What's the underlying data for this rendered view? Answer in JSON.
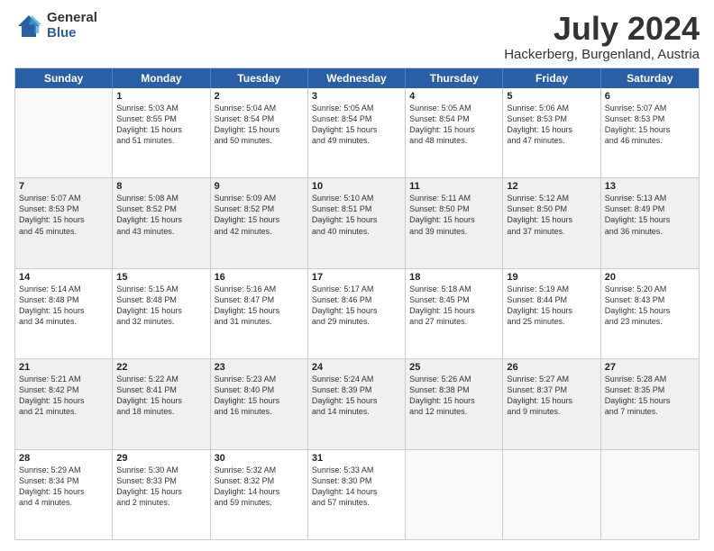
{
  "logo": {
    "general": "General",
    "blue": "Blue"
  },
  "title": "July 2024",
  "subtitle": "Hackerberg, Burgenland, Austria",
  "weekdays": [
    "Sunday",
    "Monday",
    "Tuesday",
    "Wednesday",
    "Thursday",
    "Friday",
    "Saturday"
  ],
  "rows": [
    [
      {
        "day": "",
        "text": ""
      },
      {
        "day": "1",
        "text": "Sunrise: 5:03 AM\nSunset: 8:55 PM\nDaylight: 15 hours\nand 51 minutes."
      },
      {
        "day": "2",
        "text": "Sunrise: 5:04 AM\nSunset: 8:54 PM\nDaylight: 15 hours\nand 50 minutes."
      },
      {
        "day": "3",
        "text": "Sunrise: 5:05 AM\nSunset: 8:54 PM\nDaylight: 15 hours\nand 49 minutes."
      },
      {
        "day": "4",
        "text": "Sunrise: 5:05 AM\nSunset: 8:54 PM\nDaylight: 15 hours\nand 48 minutes."
      },
      {
        "day": "5",
        "text": "Sunrise: 5:06 AM\nSunset: 8:53 PM\nDaylight: 15 hours\nand 47 minutes."
      },
      {
        "day": "6",
        "text": "Sunrise: 5:07 AM\nSunset: 8:53 PM\nDaylight: 15 hours\nand 46 minutes."
      }
    ],
    [
      {
        "day": "7",
        "text": "Sunrise: 5:07 AM\nSunset: 8:53 PM\nDaylight: 15 hours\nand 45 minutes."
      },
      {
        "day": "8",
        "text": "Sunrise: 5:08 AM\nSunset: 8:52 PM\nDaylight: 15 hours\nand 43 minutes."
      },
      {
        "day": "9",
        "text": "Sunrise: 5:09 AM\nSunset: 8:52 PM\nDaylight: 15 hours\nand 42 minutes."
      },
      {
        "day": "10",
        "text": "Sunrise: 5:10 AM\nSunset: 8:51 PM\nDaylight: 15 hours\nand 40 minutes."
      },
      {
        "day": "11",
        "text": "Sunrise: 5:11 AM\nSunset: 8:50 PM\nDaylight: 15 hours\nand 39 minutes."
      },
      {
        "day": "12",
        "text": "Sunrise: 5:12 AM\nSunset: 8:50 PM\nDaylight: 15 hours\nand 37 minutes."
      },
      {
        "day": "13",
        "text": "Sunrise: 5:13 AM\nSunset: 8:49 PM\nDaylight: 15 hours\nand 36 minutes."
      }
    ],
    [
      {
        "day": "14",
        "text": "Sunrise: 5:14 AM\nSunset: 8:48 PM\nDaylight: 15 hours\nand 34 minutes."
      },
      {
        "day": "15",
        "text": "Sunrise: 5:15 AM\nSunset: 8:48 PM\nDaylight: 15 hours\nand 32 minutes."
      },
      {
        "day": "16",
        "text": "Sunrise: 5:16 AM\nSunset: 8:47 PM\nDaylight: 15 hours\nand 31 minutes."
      },
      {
        "day": "17",
        "text": "Sunrise: 5:17 AM\nSunset: 8:46 PM\nDaylight: 15 hours\nand 29 minutes."
      },
      {
        "day": "18",
        "text": "Sunrise: 5:18 AM\nSunset: 8:45 PM\nDaylight: 15 hours\nand 27 minutes."
      },
      {
        "day": "19",
        "text": "Sunrise: 5:19 AM\nSunset: 8:44 PM\nDaylight: 15 hours\nand 25 minutes."
      },
      {
        "day": "20",
        "text": "Sunrise: 5:20 AM\nSunset: 8:43 PM\nDaylight: 15 hours\nand 23 minutes."
      }
    ],
    [
      {
        "day": "21",
        "text": "Sunrise: 5:21 AM\nSunset: 8:42 PM\nDaylight: 15 hours\nand 21 minutes."
      },
      {
        "day": "22",
        "text": "Sunrise: 5:22 AM\nSunset: 8:41 PM\nDaylight: 15 hours\nand 18 minutes."
      },
      {
        "day": "23",
        "text": "Sunrise: 5:23 AM\nSunset: 8:40 PM\nDaylight: 15 hours\nand 16 minutes."
      },
      {
        "day": "24",
        "text": "Sunrise: 5:24 AM\nSunset: 8:39 PM\nDaylight: 15 hours\nand 14 minutes."
      },
      {
        "day": "25",
        "text": "Sunrise: 5:26 AM\nSunset: 8:38 PM\nDaylight: 15 hours\nand 12 minutes."
      },
      {
        "day": "26",
        "text": "Sunrise: 5:27 AM\nSunset: 8:37 PM\nDaylight: 15 hours\nand 9 minutes."
      },
      {
        "day": "27",
        "text": "Sunrise: 5:28 AM\nSunset: 8:35 PM\nDaylight: 15 hours\nand 7 minutes."
      }
    ],
    [
      {
        "day": "28",
        "text": "Sunrise: 5:29 AM\nSunset: 8:34 PM\nDaylight: 15 hours\nand 4 minutes."
      },
      {
        "day": "29",
        "text": "Sunrise: 5:30 AM\nSunset: 8:33 PM\nDaylight: 15 hours\nand 2 minutes."
      },
      {
        "day": "30",
        "text": "Sunrise: 5:32 AM\nSunset: 8:32 PM\nDaylight: 14 hours\nand 59 minutes."
      },
      {
        "day": "31",
        "text": "Sunrise: 5:33 AM\nSunset: 8:30 PM\nDaylight: 14 hours\nand 57 minutes."
      },
      {
        "day": "",
        "text": ""
      },
      {
        "day": "",
        "text": ""
      },
      {
        "day": "",
        "text": ""
      }
    ]
  ]
}
